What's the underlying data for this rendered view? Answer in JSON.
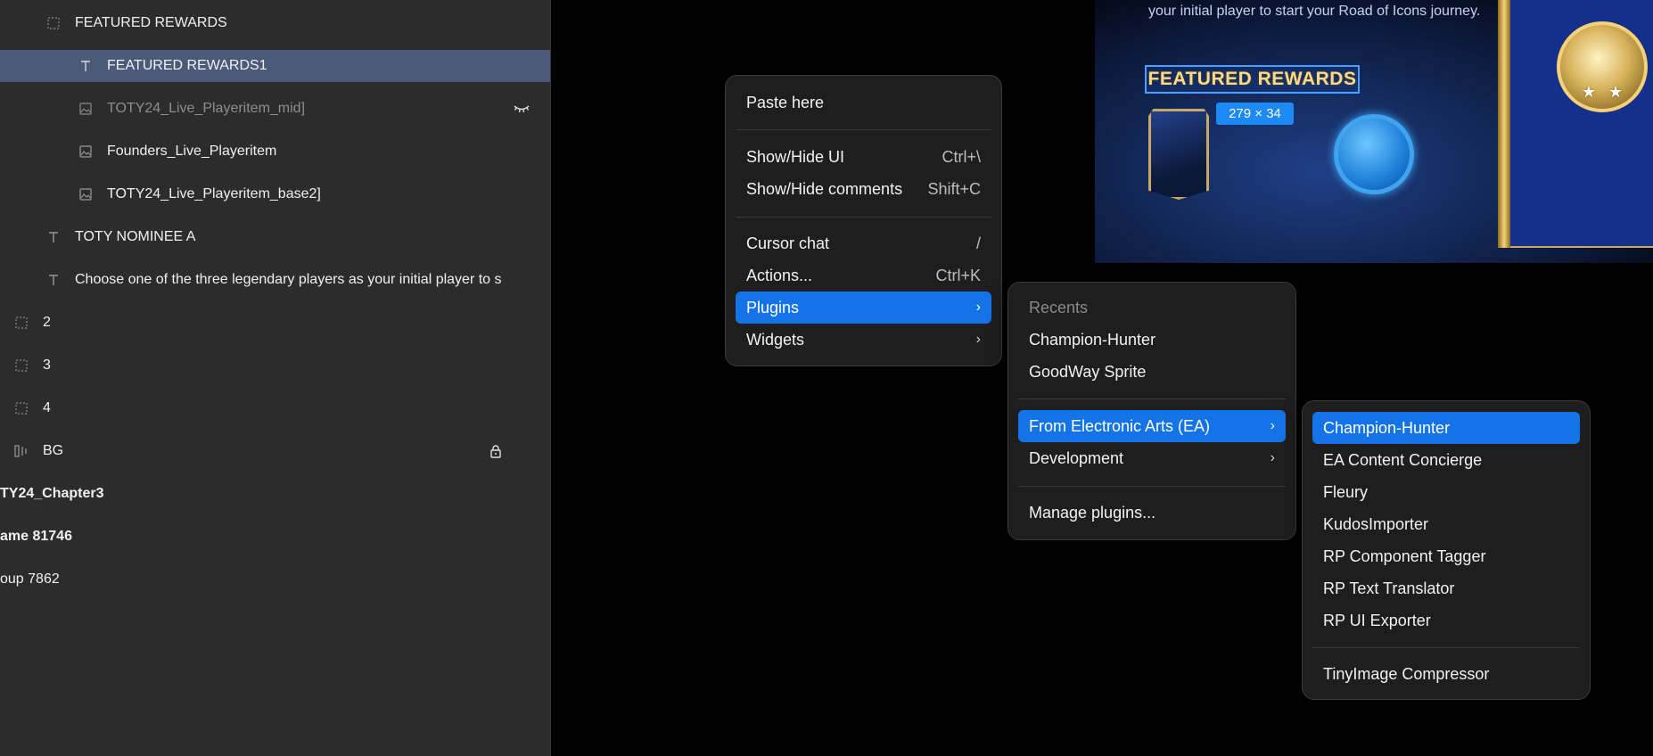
{
  "layers_panel": {
    "rows": [
      {
        "label": "FEATURED REWARDS",
        "icon": "frame-icon"
      },
      {
        "label": "FEATURED REWARDS1",
        "icon": "text-icon"
      },
      {
        "label": "TOTY24_Live_Playeritem_mid]",
        "icon": "image-icon"
      },
      {
        "label": "Founders_Live_Playeritem",
        "icon": "image-icon"
      },
      {
        "label": "TOTY24_Live_Playeritem_base2]",
        "icon": "image-icon"
      },
      {
        "label": "TOTY NOMINEE A",
        "icon": "text-icon"
      },
      {
        "label": "Choose one of the three legendary players as your initial player to s",
        "icon": "text-icon"
      },
      {
        "label": "2",
        "icon": "frame-icon"
      },
      {
        "label": "3",
        "icon": "frame-icon"
      },
      {
        "label": "4",
        "icon": "frame-icon"
      },
      {
        "label": "BG",
        "icon": "auto-layout-icon"
      },
      {
        "label": "TY24_Chapter3"
      },
      {
        "label": "ame 81746"
      },
      {
        "label": "oup 7862"
      }
    ],
    "hidden_icon": "eye-closed-icon",
    "lock_icon": "lock-icon"
  },
  "canvas": {
    "description": "your initial player to start your Road of Icons journey.",
    "featured_title": "FEATURED REWARDS",
    "size_badge": "279 × 34",
    "stars": "★★"
  },
  "context_menu": {
    "paste_here": "Paste here",
    "show_hide_ui": {
      "label": "Show/Hide UI",
      "shortcut": "Ctrl+\\"
    },
    "show_hide_comments": {
      "label": "Show/Hide comments",
      "shortcut": "Shift+C"
    },
    "cursor_chat": {
      "label": "Cursor chat",
      "shortcut": "/"
    },
    "actions": {
      "label": "Actions...",
      "shortcut": "Ctrl+K"
    },
    "plugins": {
      "label": "Plugins",
      "chevron": "›"
    },
    "widgets": {
      "label": "Widgets",
      "chevron": "›"
    }
  },
  "plugins_menu": {
    "recents_header": "Recents",
    "recents": [
      "Champion-Hunter",
      "GoodWay Sprite"
    ],
    "from_ea": {
      "label": "From Electronic Arts (EA)",
      "chevron": "›"
    },
    "development": {
      "label": "Development",
      "chevron": "›"
    },
    "manage": "Manage plugins..."
  },
  "ea_menu": {
    "items": [
      "Champion-Hunter",
      "EA Content Concierge",
      "Fleury",
      "KudosImporter",
      "RP Component Tagger",
      "RP Text Translator",
      "RP UI Exporter"
    ],
    "last": "TinyImage Compressor"
  },
  "colors": {
    "accent": "#1473e6",
    "selection": "#4a5a78",
    "panel": "#2c2c2c",
    "menu": "#1e1e1e"
  }
}
